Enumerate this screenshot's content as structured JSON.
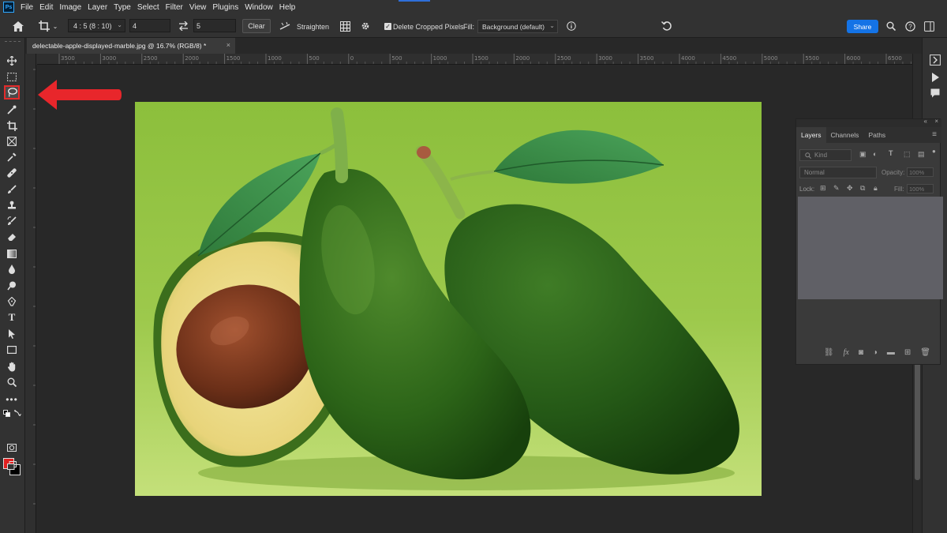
{
  "app": {
    "logo": "Ps"
  },
  "menu": [
    "File",
    "Edit",
    "Image",
    "Layer",
    "Type",
    "Select",
    "Filter",
    "View",
    "Plugins",
    "Window",
    "Help"
  ],
  "options": {
    "ratio": "4 : 5 (8 : 10)",
    "width": "4",
    "height": "5",
    "clear": "Clear",
    "straighten": "Straighten",
    "delete_cropped": "Delete Cropped Pixels",
    "delete_checked": true,
    "fill_label": "Fill:",
    "fill_value": "Background (default)",
    "share": "Share"
  },
  "document": {
    "tab_title": "delectable-apple-displayed-marble.jpg @ 16.7% (RGB/8) *",
    "close": "×"
  },
  "ruler": {
    "labels": [
      "3500",
      "3000",
      "2500",
      "2000",
      "1500",
      "1000",
      "500",
      "0",
      "500",
      "1000",
      "1500",
      "2000",
      "2500",
      "3000",
      "3500",
      "4000",
      "4500",
      "5000",
      "5500",
      "6000",
      "6500"
    ]
  },
  "layers_panel": {
    "tabs": [
      "Layers",
      "Channels",
      "Paths"
    ],
    "kind_placeholder": "Kind",
    "blend_mode": "Normal",
    "opacity_label": "Opacity:",
    "opacity_value": "100%",
    "lock_label": "Lock:",
    "fill_label": "Fill:",
    "fill_value": "100%"
  },
  "colors": {
    "foreground": "#e02020",
    "background": "#000000",
    "accent": "#1473e6",
    "annotation": "#e8262b"
  },
  "tools": [
    "move-tool",
    "marquee-tool",
    "lasso-tool",
    "object-selection-tool",
    "crop-tool",
    "frame-tool",
    "eyedropper-tool",
    "healing-brush-tool",
    "brush-tool",
    "clone-stamp-tool",
    "history-brush-tool",
    "eraser-tool",
    "gradient-tool",
    "blur-tool",
    "dodge-tool",
    "pen-tool",
    "type-tool",
    "path-selection-tool",
    "rectangle-tool",
    "hand-tool",
    "zoom-tool",
    "more-tools"
  ],
  "selected_tool": "lasso-tool"
}
